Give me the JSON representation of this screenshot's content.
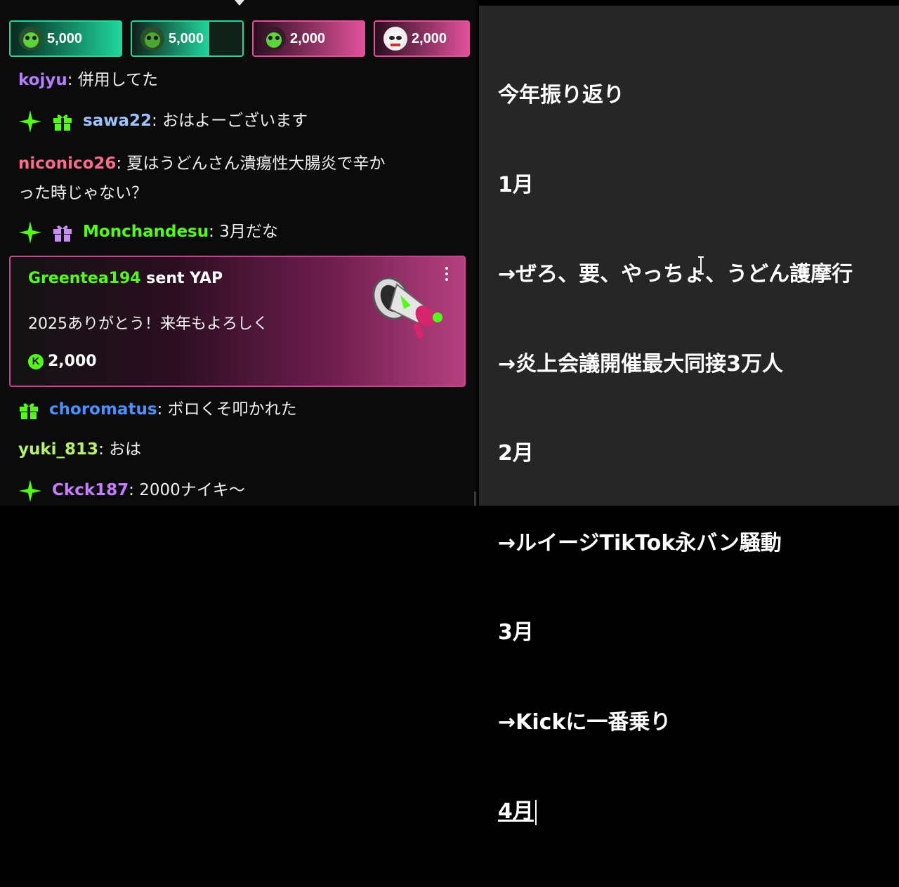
{
  "chat": {
    "pinned_tips": [
      {
        "amount": "5,000",
        "color": "#1fd69c",
        "fill_pct": 100,
        "avatar": "green-frog-avatar"
      },
      {
        "amount": "5,000",
        "color": "#1fd69c",
        "fill_pct": 70,
        "avatar": "green-frog-avatar"
      },
      {
        "amount": "2,000",
        "color": "#e0519a",
        "fill_pct": 100,
        "avatar": "green-frog-avatar"
      },
      {
        "amount": "2,000",
        "color": "#e0519a",
        "fill_pct": 100,
        "avatar": "panda-avatar"
      }
    ],
    "messages": [
      {
        "user": "kojyu",
        "user_color": "#b57dff",
        "text": "併用してた",
        "badges": []
      },
      {
        "user": "sawa22",
        "user_color": "#9ec4ff",
        "text": "おはよーございます",
        "badges": [
          "sparkle-badge-icon",
          "gift-badge-icon"
        ]
      },
      {
        "user": "niconico26",
        "user_color": "#ff6b8a",
        "text": "夏はうどんさん潰瘍性大腸炎で辛か",
        "text2": "った時じゃない？",
        "badges": []
      },
      {
        "user": "Monchandesu",
        "user_color": "#53fc18",
        "text": "3月だな",
        "badges": [
          "sparkle-badge-icon",
          "gift-badge-icon"
        ]
      },
      {
        "user": "choromatus",
        "user_color": "#4a90ff",
        "text": "ボロくそ叩かれた",
        "badges": [
          "gift-badge-icon"
        ]
      },
      {
        "user": "yuki_813",
        "user_color": "#b5f26a",
        "text": "おは",
        "badges": []
      },
      {
        "user": "Ckck187",
        "user_color": "#c77dff",
        "text": "2000ナイキ〜",
        "badges": [
          "sparkle-badge-icon"
        ]
      }
    ],
    "yap_card": {
      "user": "Greentea194",
      "user_color": "#53fc18",
      "action": "sent YAP",
      "message": "2025ありがとう！来年もよろしく",
      "amount": "2,000",
      "coin_label": "K"
    }
  },
  "notes": {
    "lines": [
      "今年振り返り",
      "1月",
      "→ぜろ、要、やっちょ、うどん護摩行",
      "→炎上会議開催最大同接3万人",
      "2月",
      "→ルイージTikTok永バン騒動",
      "3月",
      "→Kickに一番乗り",
      "4月"
    ]
  },
  "colors": {
    "kick_green": "#53fc18",
    "notes_bg": "#262626",
    "chat_bg": "#0b0b0c"
  }
}
